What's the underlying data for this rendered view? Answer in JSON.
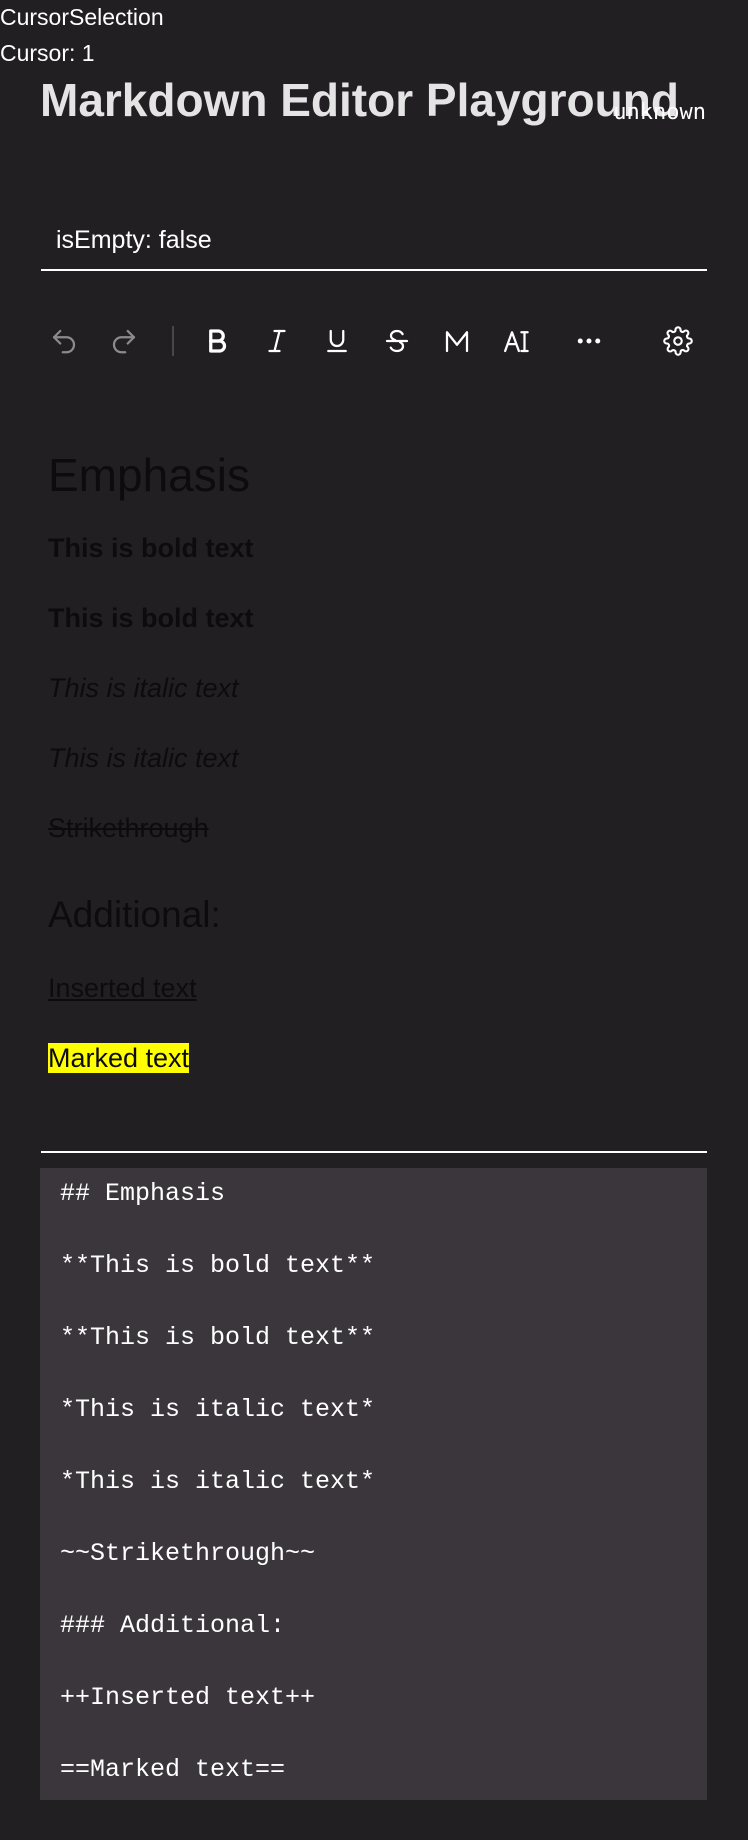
{
  "debug": {
    "selection_label": "CursorSelection",
    "cursor_label": "Cursor: 1"
  },
  "header": {
    "title": "Markdown Editor Playground",
    "status": "unknown"
  },
  "editor_state": {
    "is_empty_label": "isEmpty: false"
  },
  "toolbar": {
    "items": [
      {
        "name": "undo",
        "icon": "undo-icon",
        "enabled": false
      },
      {
        "name": "redo",
        "icon": "redo-icon",
        "enabled": false
      },
      {
        "name": "bold",
        "icon": "bold-icon",
        "enabled": true
      },
      {
        "name": "italic",
        "icon": "italic-icon",
        "enabled": true
      },
      {
        "name": "underline",
        "icon": "underline-icon",
        "enabled": true
      },
      {
        "name": "strikethrough",
        "icon": "strikethrough-icon",
        "enabled": true
      },
      {
        "name": "mark",
        "icon": "mark-icon",
        "enabled": true
      },
      {
        "name": "text-format",
        "icon": "text-format-icon",
        "enabled": true
      },
      {
        "name": "more",
        "icon": "more-icon",
        "enabled": true
      },
      {
        "name": "settings",
        "icon": "gear-icon",
        "enabled": true
      }
    ]
  },
  "preview": {
    "heading": "Emphasis",
    "bold_1": "This is bold text",
    "bold_2": "This is bold text",
    "italic_1": "This is italic text",
    "italic_2": "This is italic text",
    "strikethrough": "Strikethrough",
    "subheading": "Additional:",
    "inserted": "Inserted text",
    "marked": "Marked text"
  },
  "source": {
    "lines": [
      "## Emphasis",
      "**This is bold text**",
      "**This is bold text**",
      "*This is italic text*",
      "*This is italic text*",
      "~~Strikethrough~~",
      "### Additional:",
      "++Inserted text++",
      "==Marked text=="
    ]
  },
  "colors": {
    "background": "#221f23",
    "source_background": "#3a363c",
    "highlight": "#ffff00",
    "disabled_icon": "#8d8a8f",
    "preview_text": "#0d0b0e"
  }
}
